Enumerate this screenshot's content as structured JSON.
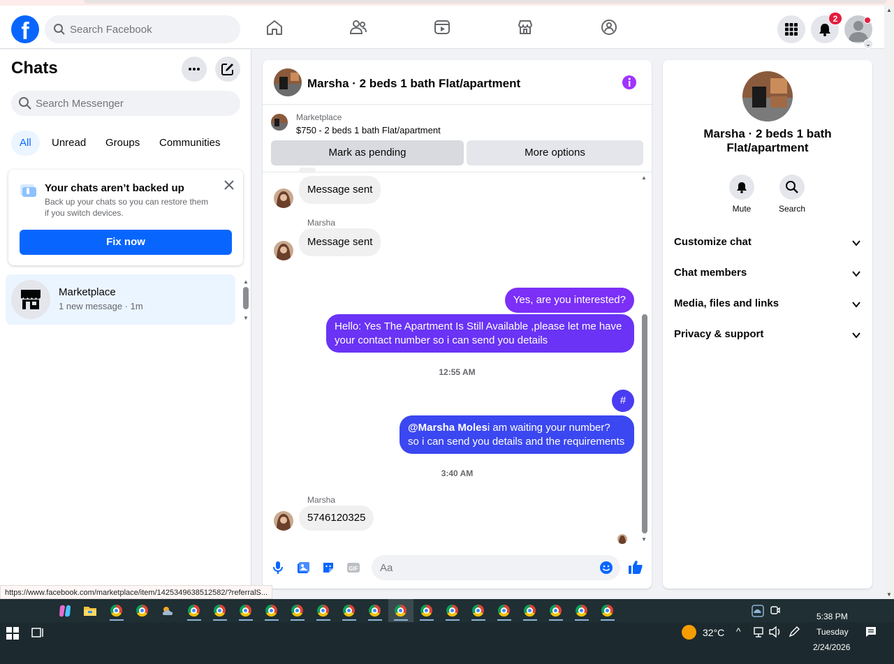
{
  "header": {
    "search_placeholder": "Search Facebook",
    "notification_count": "2",
    "nav_icons": [
      "home-icon",
      "friends-icon",
      "video-icon",
      "marketplace-icon",
      "groups-icon"
    ]
  },
  "sidebar": {
    "title": "Chats",
    "search_placeholder": "Search Messenger",
    "filters": [
      "All",
      "Unread",
      "Groups",
      "Communities"
    ],
    "active_filter": "All",
    "backup": {
      "title": "Your chats aren’t backed up",
      "body": "Back up your chats so you can restore them if you switch devices.",
      "button": "Fix now"
    },
    "threads": [
      {
        "name": "Marketplace",
        "subtitle": "1 new message · 1m"
      }
    ]
  },
  "conversation": {
    "title": "Marsha · 2 beds 1 bath Flat/apartment",
    "marketplace": {
      "label": "Marketplace",
      "listing": "$750 - 2 beds 1 bath Flat/apartment",
      "pending_button": "Mark as pending",
      "more_button": "More options"
    },
    "messages": [
      {
        "from": "them",
        "text": "Message sent"
      },
      {
        "from": "them",
        "sender": "Marsha",
        "text": "Message sent"
      },
      {
        "from": "me",
        "text": "Yes, are you interested?"
      },
      {
        "from": "me",
        "text": "Hello: Yes The Apartment Is Still Available ,please let me have your contact number so i can send you details"
      },
      {
        "timestamp": "12:55 AM"
      },
      {
        "from": "me",
        "text": "#"
      },
      {
        "from": "me",
        "mention": "@Marsha Moles",
        "text": "i am waiting your number?",
        "text2": "so i can send you details and the requirements"
      },
      {
        "timestamp": "3:40 AM"
      },
      {
        "from": "them",
        "sender": "Marsha",
        "text": "5746120325"
      }
    ],
    "composer_placeholder": "Aa"
  },
  "info_panel": {
    "name": "Marsha · 2 beds 1 bath Flat/apartment",
    "actions": [
      "Mute",
      "Search"
    ],
    "sections": [
      "Customize chat",
      "Chat members",
      "Media, files and links",
      "Privacy & support"
    ]
  },
  "status_url": "https://www.facebook.com/marketplace/item/1425349638512582/?referralS...",
  "taskbar": {
    "weather": "32°C",
    "time": "5:38 PM",
    "day": "Tuesday",
    "date": "2/24/2026"
  },
  "colors": {
    "brand": "#0866ff",
    "bubble_purple": "#7b2ff7",
    "bubble_indigo": "#5a35f0",
    "bubble_blue": "#3b47f0",
    "badge_red": "#e41e3f"
  }
}
